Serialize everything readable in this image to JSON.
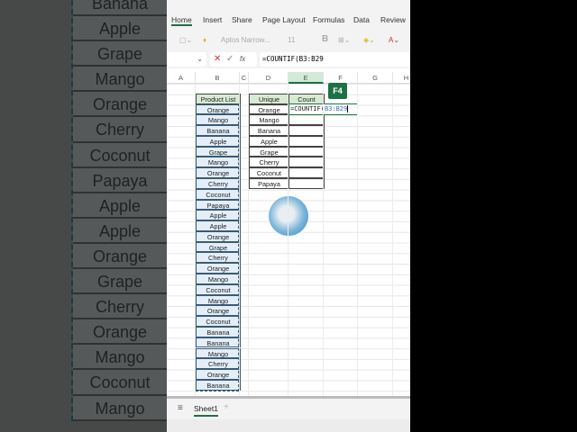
{
  "ribbon": {
    "tabs": [
      "Home",
      "Insert",
      "Share",
      "Page Layout",
      "Formulas",
      "Data",
      "Review"
    ],
    "font": "Aptos Narrow...",
    "size": "11"
  },
  "formula_bar": {
    "fx": "fx",
    "formula": "=COUNTIF(B3:B29"
  },
  "columns": [
    "A",
    "B",
    "C",
    "D",
    "E",
    "F",
    "G",
    "H"
  ],
  "product_header": "Product List",
  "products": [
    "Orange",
    "Mango",
    "Banana",
    "Apple",
    "Grape",
    "Mango",
    "Orange",
    "Cherry",
    "Coconut",
    "Papaya",
    "Apple",
    "Apple",
    "Orange",
    "Grape",
    "Cherry",
    "Orange",
    "Mango",
    "Coconut",
    "Mango",
    "Orange",
    "Coconut",
    "Banana",
    "Banana",
    "Mango",
    "Cherry",
    "Orange",
    "Banana"
  ],
  "unique_header": "Unique",
  "count_header": "Count",
  "unique": [
    "Orange",
    "Mango",
    "Banana",
    "Apple",
    "Grape",
    "Cherry",
    "Coconut",
    "Papaya"
  ],
  "active_cell": {
    "prefix": "=COUNTIF(",
    "ref": "B3:B29"
  },
  "key_badge": "F4",
  "sheet_tab": "Sheet1",
  "add_sheet": "+",
  "background_list": [
    "Banana",
    "Apple",
    "Grape",
    "Mango",
    "Orange",
    "Cherry",
    "Coconut",
    "Papaya",
    "Apple",
    "Apple",
    "Orange",
    "Grape",
    "Cherry",
    "Orange",
    "Mango",
    "Coconut",
    "Mango"
  ]
}
